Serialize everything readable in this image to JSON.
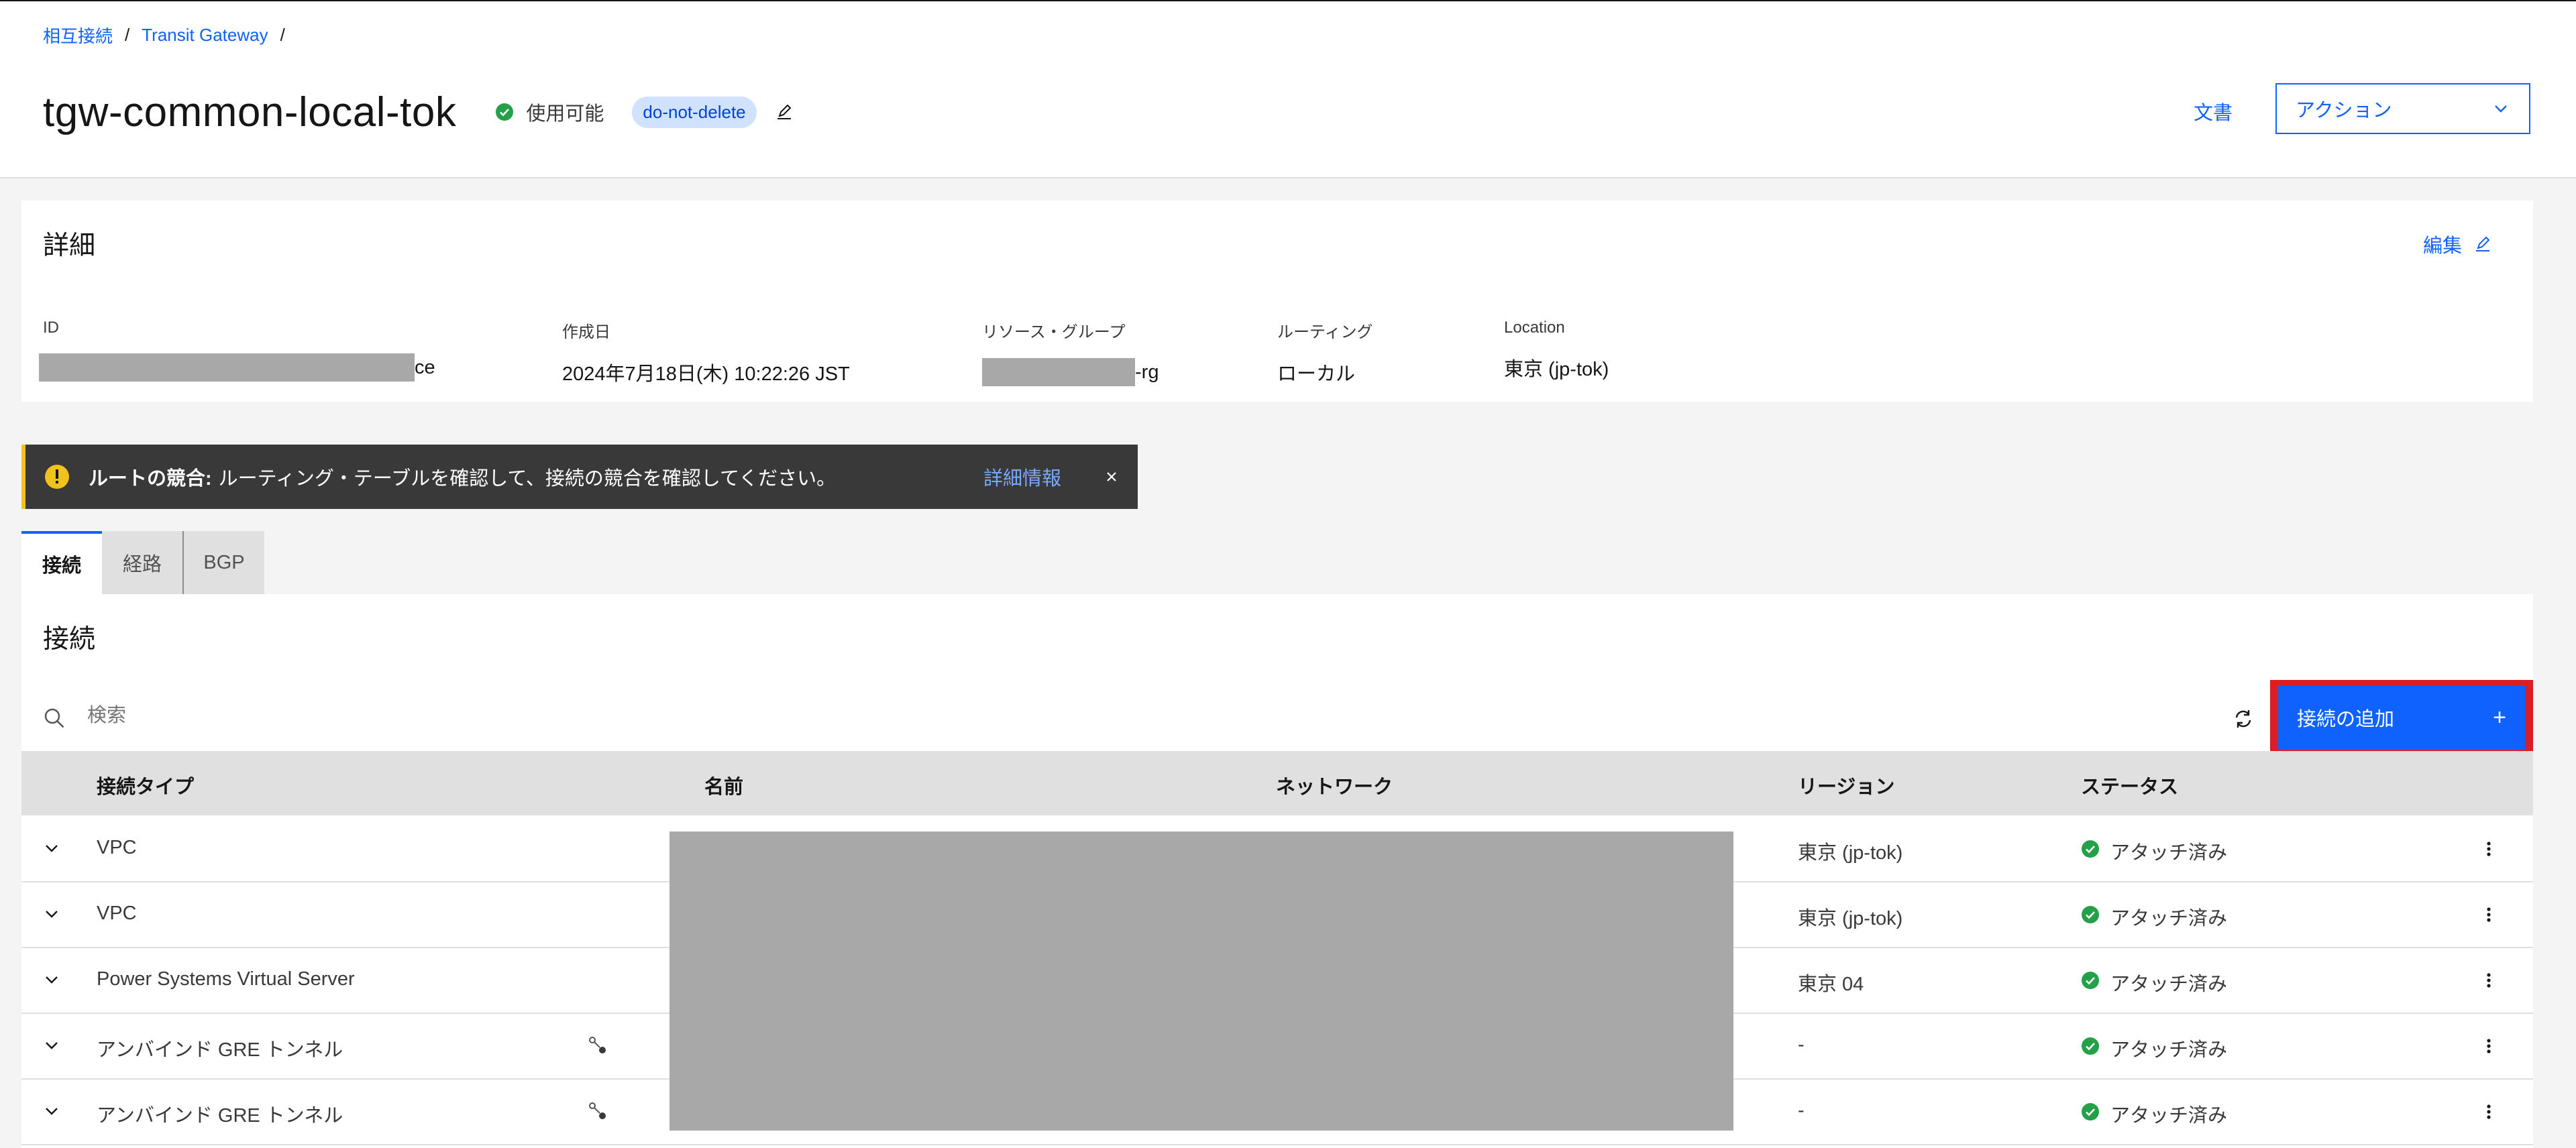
{
  "breadcrumb": {
    "items": [
      "相互接続",
      "Transit Gateway"
    ],
    "separator": "/"
  },
  "header": {
    "title": "tgw-common-local-tok",
    "status": "使用可能",
    "tag": "do-not-delete",
    "docs_link": "文書",
    "action_label": "アクション"
  },
  "details": {
    "heading": "詳細",
    "edit_label": "編集",
    "fields": {
      "id": {
        "label": "ID",
        "value_suffix": "ce"
      },
      "created": {
        "label": "作成日",
        "value": "2024年7月18日(木) 10:22:26 JST"
      },
      "resource_group": {
        "label": "リソース・グループ",
        "value_suffix": "-rg"
      },
      "routing": {
        "label": "ルーティング",
        "value": "ローカル"
      },
      "location": {
        "label": "Location",
        "value": "東京 (jp-tok)"
      }
    }
  },
  "notification": {
    "title": "ルートの競合:",
    "message": "ルーティング・テーブルを確認して、接続の競合を確認してください。",
    "link": "詳細情報"
  },
  "tabs": [
    "接続",
    "経路",
    "BGP"
  ],
  "connections": {
    "heading": "接続",
    "search_placeholder": "検索",
    "add_button": "接続の追加",
    "columns": [
      "接続タイプ",
      "名前",
      "ネットワーク",
      "リージョン",
      "ステータス"
    ],
    "rows": [
      {
        "type": "VPC",
        "region": "東京 (jp-tok)",
        "status": "アタッチ済み"
      },
      {
        "type": "VPC",
        "region": "東京 (jp-tok)",
        "status": "アタッチ済み"
      },
      {
        "type": "Power Systems Virtual Server",
        "region": "東京 04",
        "status": "アタッチ済み"
      },
      {
        "type": "アンバインド GRE トンネル",
        "region": "-",
        "status": "アタッチ済み"
      },
      {
        "type": "アンバインド GRE トンネル",
        "region": "-",
        "status": "アタッチ済み"
      }
    ]
  },
  "colors": {
    "accent": "#0f62fe",
    "success": "#24a148",
    "warning": "#f1c21b",
    "highlight_border": "#da1e28",
    "redaction": "#a8a8a8"
  }
}
